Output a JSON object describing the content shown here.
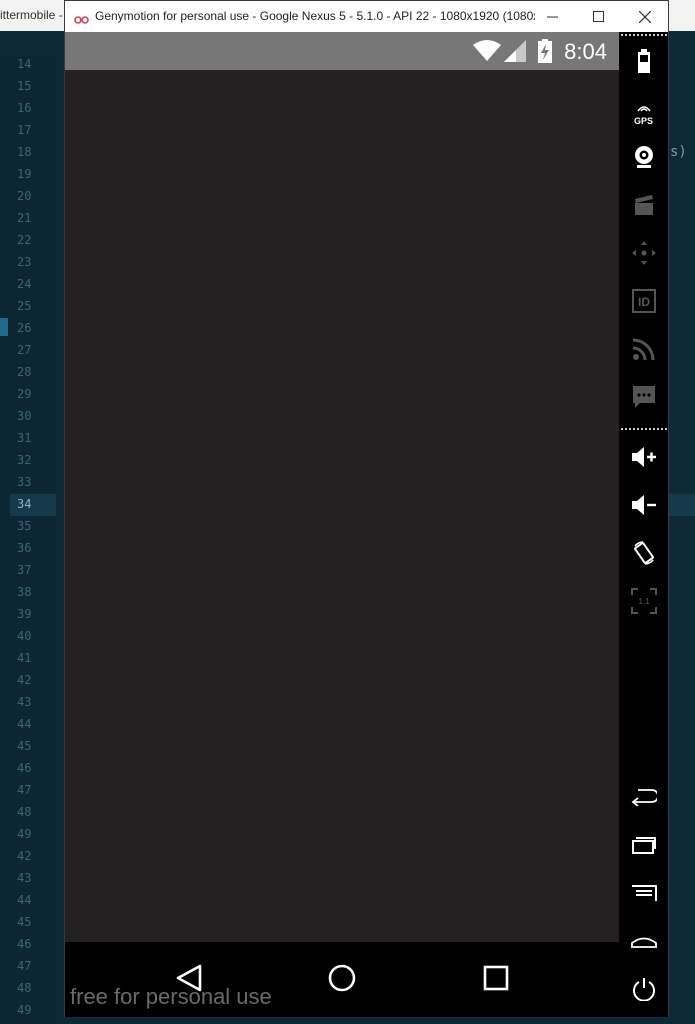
{
  "editor": {
    "tab_text": "ittermobile -",
    "line_numbers": [
      "14",
      "15",
      "16",
      "17",
      "18",
      "19",
      "20",
      "21",
      "22",
      "23",
      "24",
      "25",
      "26",
      "27",
      "28",
      "29",
      "30",
      "31",
      "32",
      "33",
      "34",
      "35",
      "36",
      "37",
      "38",
      "39",
      "40",
      "41",
      "42",
      "43",
      "44",
      "45",
      "46",
      "47",
      "48",
      "49",
      "42",
      "43",
      "44",
      "45",
      "46",
      "47",
      "48",
      "49"
    ],
    "active_line": "34",
    "code_fragment": "s)"
  },
  "window": {
    "title": "Genymotion for personal use - Google Nexus 5 - 5.1.0 - API 22 - 1080x1920 (1080x...",
    "controls": [
      "minimize-icon",
      "maximize-icon",
      "close-icon"
    ]
  },
  "status_bar": {
    "time": "8:04",
    "icons": [
      "wifi-icon",
      "signal-icon",
      "battery-charging-icon"
    ]
  },
  "nav_bar": {
    "buttons": [
      "back-icon",
      "home-icon",
      "recents-icon"
    ],
    "watermark": "free for personal use"
  },
  "toolbar": {
    "gps_label": "GPS",
    "tools": [
      "battery-icon",
      "gps-icon",
      "webcam-icon",
      "video-capture-icon",
      "move-icon",
      "device-id-icon",
      "cast-icon",
      "sms-icon",
      "volume-up-icon",
      "volume-down-icon",
      "rotate-icon",
      "pixel-perfect-icon",
      "back-icon",
      "recents-icon",
      "menu-icon",
      "home-icon",
      "power-icon"
    ],
    "scale_label": "1:1"
  },
  "colors": {
    "editor_bg": "#0f2a37",
    "status_bar": "#777777",
    "app_bg": "#252022",
    "toolbar_bg": "#000000"
  }
}
